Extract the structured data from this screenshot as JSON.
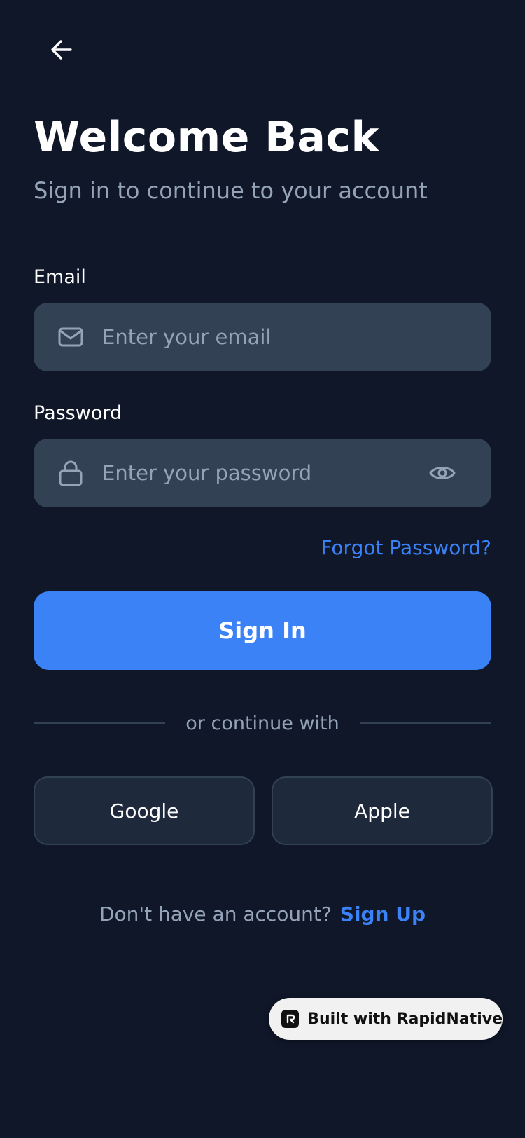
{
  "header": {
    "back_icon": "arrow-left-icon",
    "title": "Welcome Back",
    "subtitle": "Sign in to continue to your account"
  },
  "form": {
    "email": {
      "label": "Email",
      "placeholder": "Enter your email",
      "icon": "mail-icon"
    },
    "password": {
      "label": "Password",
      "placeholder": "Enter your password",
      "icon": "lock-icon",
      "toggle_icon": "eye-icon"
    },
    "forgot_label": "Forgot Password?",
    "submit_label": "Sign In"
  },
  "divider": {
    "text": "or continue with"
  },
  "social": {
    "google_label": "Google",
    "apple_label": "Apple"
  },
  "footer": {
    "prompt": "Don't have an account?",
    "signup_label": "Sign Up"
  },
  "badge": {
    "text": "Built with RapidNative",
    "icon": "rapidnative-logo-icon"
  },
  "colors": {
    "background": "#0f1729",
    "input_bg": "#334155",
    "accent": "#3b82f6",
    "muted_text": "#94a3b8",
    "social_bg": "#1e293b"
  }
}
